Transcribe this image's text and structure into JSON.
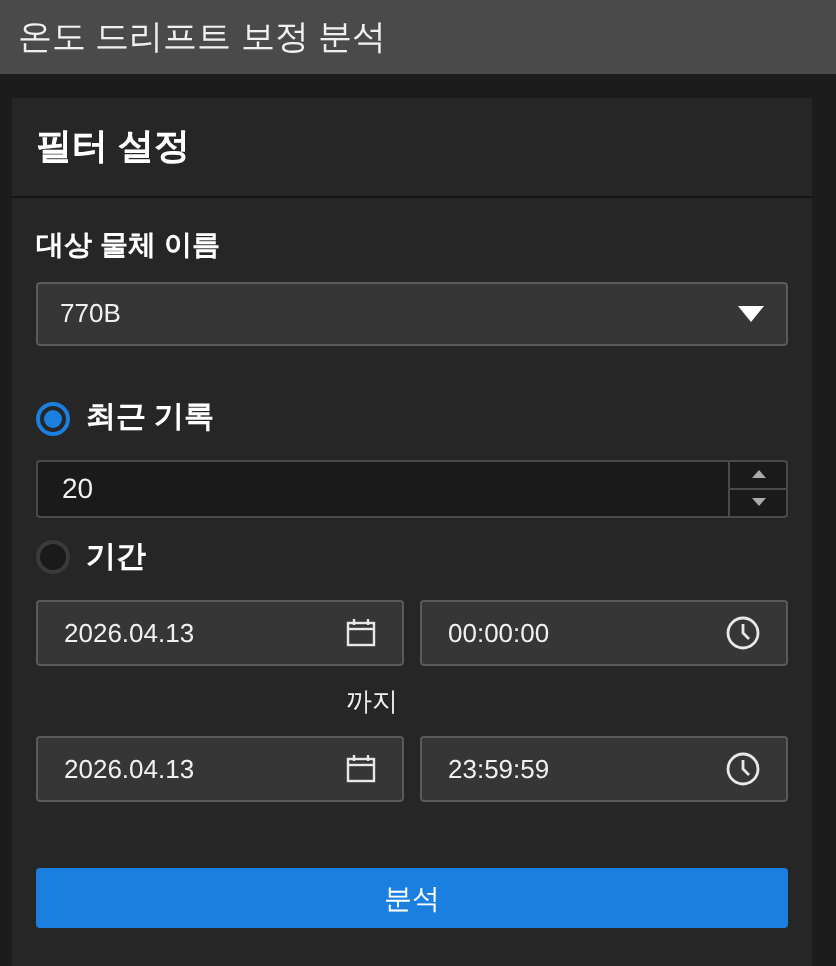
{
  "window": {
    "title": "온도 드리프트 보정 분석"
  },
  "panel": {
    "title": "필터 설정"
  },
  "target": {
    "label": "대상 물체 이름",
    "value": "770B"
  },
  "modes": [
    {
      "label": "최근 기록",
      "selected": true
    },
    {
      "label": "기간",
      "selected": false
    }
  ],
  "record_count": {
    "value": "20"
  },
  "period": {
    "start_date": "2026.04.13",
    "start_time": "00:00:00",
    "separator": "까지",
    "end_date": "2026.04.13",
    "end_time": "23:59:59"
  },
  "button": {
    "label": "분석"
  }
}
